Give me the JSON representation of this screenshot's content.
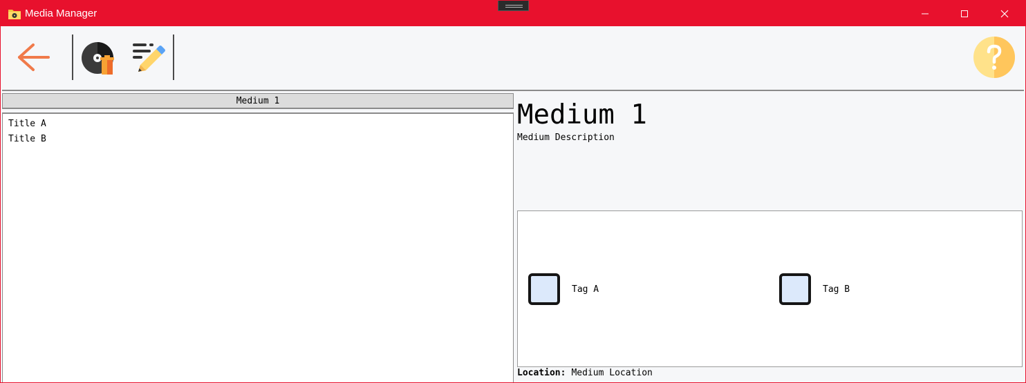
{
  "window": {
    "title": "Media Manager",
    "accent": "#e8112d"
  },
  "toolbar": {
    "icons": [
      "back-arrow-icon",
      "disc-trash-icon",
      "edit-pencil-icon",
      "help-icon"
    ]
  },
  "left_panel": {
    "header": "Medium 1",
    "items": [
      {
        "label": "Title A"
      },
      {
        "label": "Title B"
      }
    ]
  },
  "details": {
    "title": "Medium 1",
    "description": "Medium Description",
    "tags": [
      {
        "label": "Tag A"
      },
      {
        "label": "Tag B"
      }
    ],
    "location_label": "Location:",
    "location_value": "Medium Location"
  }
}
